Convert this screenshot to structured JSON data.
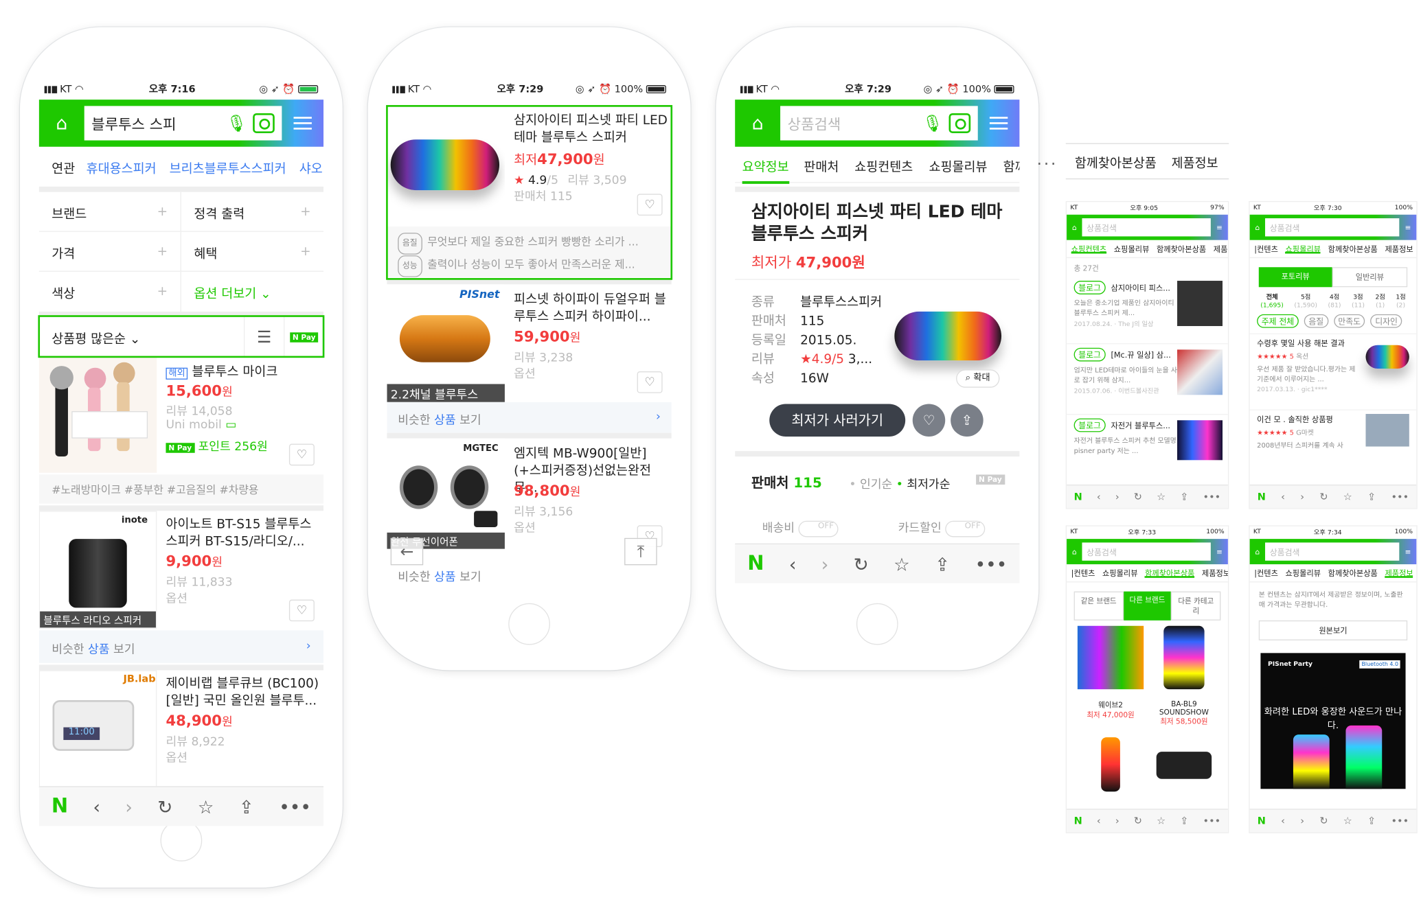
{
  "status": {
    "carrier": "KT",
    "time1": "오후 7:16",
    "time2": "오후 7:29",
    "time3": "오후 7:29",
    "battery": "100%"
  },
  "phone1": {
    "search_value": "블루투스 스피",
    "related_tabs": [
      "연관",
      "휴대용스피커",
      "브리츠블루투스스피커",
      "샤오미"
    ],
    "filters": [
      "브랜드",
      "정격 출력",
      "가격",
      "혜택",
      "색상"
    ],
    "more_options": "옵션 더보기",
    "sort": "상품평 많은순",
    "npay": "Pay",
    "items": [
      {
        "badge": "해외",
        "title": "블루투스 마이크",
        "price": "15,600",
        "won": "원",
        "review": "리뷰 14,058",
        "seller": "Uni mobil",
        "point": "포인트 256원",
        "tags": "#노래방마이크   #풍부한   #고음질의   #차량용"
      },
      {
        "title": "아이노트 BT-S15 블루투스 스피커 BT-S15/라디오/...",
        "price": "9,900",
        "won": "원",
        "review": "리뷰 11,833",
        "option": "옵션",
        "caption": "블루투스 라디오 스피커",
        "brand": "inote"
      },
      {
        "title": "제이비랩 블루큐브 (BC100) [일반] 국민 올인원 블루투...",
        "price": "48,900",
        "won": "원",
        "review": "리뷰 8,922",
        "option": "옵션",
        "brand": "JB.lab"
      }
    ],
    "similar": "비슷한 상품 보기",
    "similar_hl": "상품"
  },
  "phone2": {
    "items": [
      {
        "title": "삼지아이티 피스넷 파티 LED 테마 블루투스 스피커",
        "lowest": "최저",
        "price": "47,900",
        "won": "원",
        "rating": "4.9",
        "rating_max": "/5",
        "review": "리뷰 3,509",
        "sellers": "판매처 115"
      },
      {
        "title": "피스넷 하이파이 듀얼우퍼 블루투스 스피커 하이파이...",
        "price": "59,900",
        "won": "원",
        "review": "리뷰 3,238",
        "option": "옵션",
        "caption": "2.2채널 블루투스",
        "brand": "PISnet"
      },
      {
        "title": "엠지텍 MB-W900[일반] (+스피커증정)선없는완전무...",
        "price": "98,800",
        "won": "원",
        "review": "리뷰 3,156",
        "option": "옵션",
        "caption": "완전 무선이어폰",
        "brand": "MGTEC"
      }
    ],
    "reviews": [
      {
        "chip": "음질",
        "text": "무엇보다 제일 중요한 스피커 빵빵한 소리가 ..."
      },
      {
        "chip": "성능",
        "text": "출력이나 성능이 모두 좋아서 만족스러운 제..."
      }
    ],
    "similar": "비슷한 상품 보기",
    "similar_hl": "상품"
  },
  "phone3": {
    "placeholder": "상품검색",
    "tabs": [
      "요약정보",
      "판매처",
      "쇼핑컨텐츠",
      "쇼핑몰리뷰",
      "함께"
    ],
    "title": "삼지아이티 피스넷 파티 LED 테마 블루투스 스피커",
    "lowest_label": "최저가",
    "price": "47,900원",
    "specs": [
      {
        "k": "종류",
        "v": "블루투스스피커"
      },
      {
        "k": "판매처",
        "v": "115"
      },
      {
        "k": "등록일",
        "v": "2015.05."
      },
      {
        "k": "리뷰",
        "v": "4.9/5",
        "v2": "3,..."
      },
      {
        "k": "속성",
        "v": "16W"
      }
    ],
    "zoom": "확대",
    "buy_button": "최저가 사러가기",
    "sellers_label": "판매처",
    "sellers_count": "115",
    "sort1": "인기순",
    "sort2": "최저가순",
    "shipping": "배송비",
    "card": "카드할인",
    "off": "OFF"
  },
  "ellipsis": "...",
  "right_tabs": [
    "함께찾아본상품",
    "제품정보"
  ],
  "minis": [
    {
      "tabs": [
        "쇼핑컨텐츠",
        "쇼핑몰리뷰",
        "함께찾아본상품",
        "제품정"
      ],
      "count": "총 27건",
      "rows": [
        {
          "tag": "블로그",
          "title": "삼지아이티 피스...",
          "desc": "오늘은 중소기업 제품인 삼지아이티 블루투스 스피커 제...",
          "date": "2017.08.24. · The J의 일상"
        },
        {
          "tag": "블로그",
          "title": "[Mc.뀨 일상] 삼...",
          "desc": "엄지만 LED테마로 아이들의 눈을 사로 잡기 위해 삼지...",
          "date": "2015.07.06. · 이번드볼사진관"
        },
        {
          "tag": "블로그",
          "title": "자전거 블루투스...",
          "desc": "자전거 블루투스 스피커 추천 모델명 pisner party 저는 ...",
          "date": ""
        }
      ]
    },
    {
      "tabs": [
        "|컨텐츠",
        "쇼핑몰리뷰",
        "함께찾아본상품",
        "제품정보"
      ],
      "seg": [
        "포토리뷰",
        "일반리뷰"
      ],
      "scores": [
        "전체",
        "5점",
        "4점",
        "3점",
        "2점",
        "1점"
      ],
      "score_counts": [
        "(1,695)",
        "(1,590)",
        "(81)",
        "(11)",
        "(1)",
        "(2)"
      ],
      "chips": [
        "주제 전체",
        "음질",
        "만족도",
        "디자인"
      ],
      "reviews": [
        {
          "title": "수령후 몇일 사용 해본 결과",
          "stars": "★★★★★ 5",
          "shop": "옥션",
          "body": "우선 제품 잘 받았습니다.평가는 제 기준에서 이루어지는 ...",
          "date": "2017.03.13. · gic1****"
        },
        {
          "title": "이건 모 . 솔직한 상품평",
          "stars": "★★★★★ 5",
          "shop": "G마켓",
          "body": "2008년부터 스피커를 계속 사",
          "date": ""
        }
      ]
    },
    {
      "tabs": [
        "|컨텐츠",
        "쇼핑몰리뷰",
        "함께찾아본상품",
        "제품정보"
      ],
      "seg": [
        "같은 브랜드",
        "다른 브랜드",
        "다른 카테고리"
      ],
      "products": [
        {
          "name": "웨이브2",
          "price": "최저 47,000원"
        },
        {
          "name": "BA-BL9 SOUNDSHOW",
          "price": "최저 58,500원"
        }
      ]
    },
    {
      "tabs": [
        "|컨텐츠",
        "쇼핑몰리뷰",
        "함께찾아본상품",
        "제품정보"
      ],
      "notice": "본 컨텐츠는 삼지IT에서 제공받은 정보이며, 노출판매 가격과는 무관합니다.",
      "original": "원본보기",
      "banner_brand": "PISnet Party",
      "banner_bt": "Bluetooth 4.0",
      "banner_text": "화려한 LED와 웅장한 사운드가 만나다."
    }
  ],
  "mini_status": [
    {
      "carrier": "KT",
      "time": "오후 9:05",
      "battery": "97%"
    },
    {
      "carrier": "KT",
      "time": "오후 7:30",
      "battery": "100%"
    },
    {
      "carrier": "KT",
      "time": "오후 7:33",
      "battery": "100%"
    },
    {
      "carrier": "KT",
      "time": "오후 7:34",
      "battery": "100%"
    }
  ],
  "mini_placeholder": "상품검색"
}
